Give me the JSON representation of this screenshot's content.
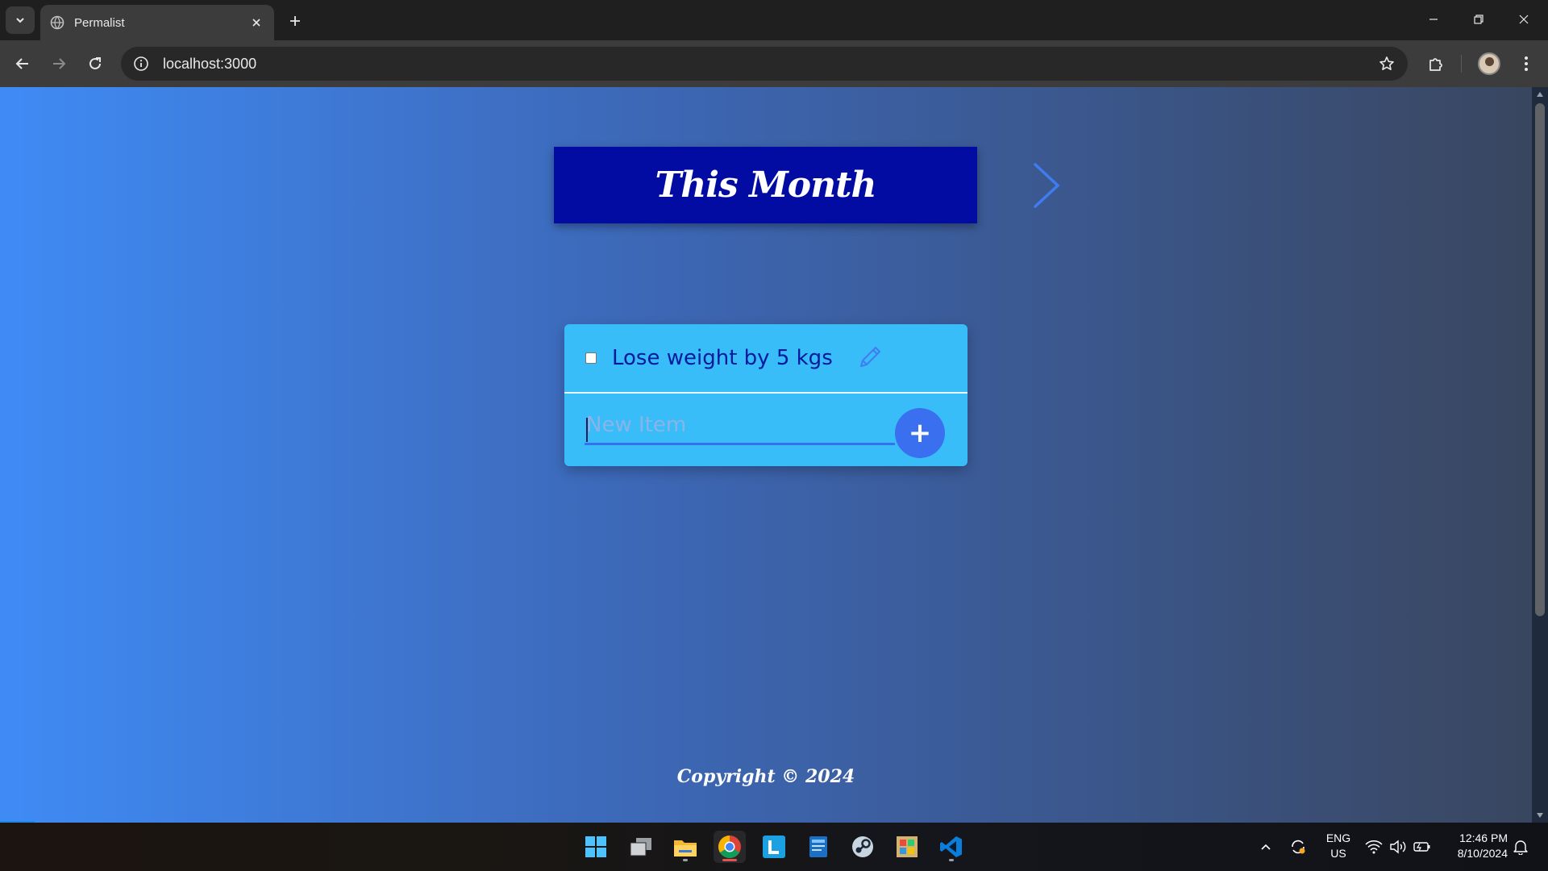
{
  "browser": {
    "tab_title": "Permalist",
    "url": "localhost:3000"
  },
  "page": {
    "heading": "This Month",
    "items": [
      {
        "text": "Lose weight by 5 kgs",
        "checked": false
      }
    ],
    "new_item_placeholder": "New Item",
    "add_button_label": "+",
    "footer": "Copyright © 2024"
  },
  "taskbar": {
    "lang_line1": "ENG",
    "lang_line2": "US",
    "time": "12:46 PM",
    "date": "8/10/2024"
  },
  "colors": {
    "heading_bg": "#020ca3",
    "card_bg": "#38bdf8",
    "item_text": "#031a9e",
    "add_button": "#3a6ff0",
    "gradient_start": "#3f8bf5",
    "gradient_end": "#39465f"
  }
}
